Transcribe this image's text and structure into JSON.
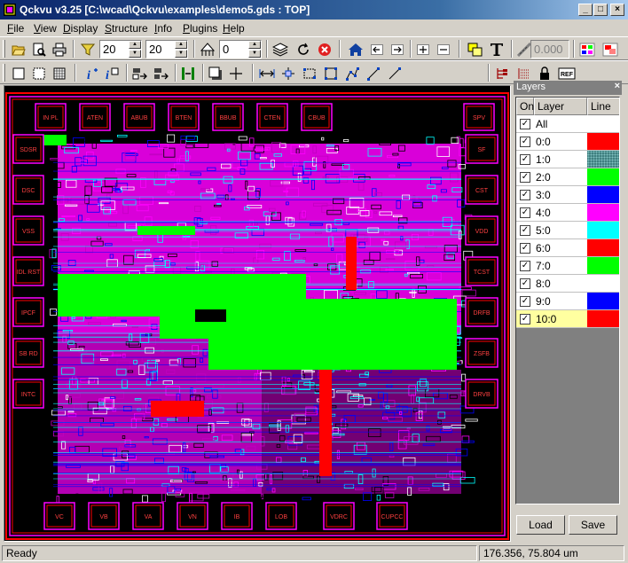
{
  "window": {
    "title": "Qckvu v3.25 [C:\\wcad\\Qckvu\\examples\\demo5.gds : TOP]"
  },
  "menu": [
    {
      "label": "File",
      "key": "F",
      "rest": "ile"
    },
    {
      "label": "View",
      "key": "V",
      "rest": "iew"
    },
    {
      "label": "Display",
      "key": "D",
      "rest": "isplay"
    },
    {
      "label": "Structure",
      "key": "S",
      "rest": "tructure"
    },
    {
      "label": "Info",
      "key": "I",
      "rest": "nfo"
    },
    {
      "label": "Plugins",
      "key": "P",
      "rest": "lugins"
    },
    {
      "label": "Help",
      "key": "H",
      "rest": "elp"
    }
  ],
  "toolbar": {
    "spin1": "20",
    "spin2": "20",
    "spin3": "0",
    "coord_value": "0.000",
    "ref_label": "REF"
  },
  "layers_panel": {
    "title": "Layers",
    "col_on": "On",
    "col_layer": "Layer",
    "col_line": "Line",
    "load_label": "Load",
    "save_label": "Save",
    "rows": [
      {
        "name": "All",
        "color": ""
      },
      {
        "name": "0:0",
        "color": "#ff0000"
      },
      {
        "name": "1:0",
        "color": "#408080"
      },
      {
        "name": "2:0",
        "color": "#00ff00"
      },
      {
        "name": "3:0",
        "color": "#0000ff"
      },
      {
        "name": "4:0",
        "color": "#ff00ff"
      },
      {
        "name": "5:0",
        "color": "#00ffff"
      },
      {
        "name": "6:0",
        "color": "#ff0000"
      },
      {
        "name": "7:0",
        "color": "#00ff00"
      },
      {
        "name": "8:0",
        "color": "#ffffff"
      },
      {
        "name": "9:0",
        "color": "#0000ff"
      },
      {
        "name": "10:0",
        "color": "#ff0000"
      }
    ]
  },
  "pad_labels": [
    "IN PL",
    "ATEN",
    "ABUB",
    "BTEN",
    "BBUB",
    "CTEN",
    "CBUB",
    "SPV",
    "SDSR",
    "SF",
    "DSC",
    "CST",
    "VSS",
    "VDD",
    "IDL RST",
    "TCST",
    "IPCF",
    "DRFB",
    "SB RD",
    "ZSFB",
    "INTC",
    "DRVB",
    "VC",
    "VB",
    "VA",
    "VN",
    "IB",
    "LOB",
    "VDRC",
    "CUPCC"
  ],
  "status": {
    "left": "Ready",
    "right": "176.356, 75.804 um"
  }
}
